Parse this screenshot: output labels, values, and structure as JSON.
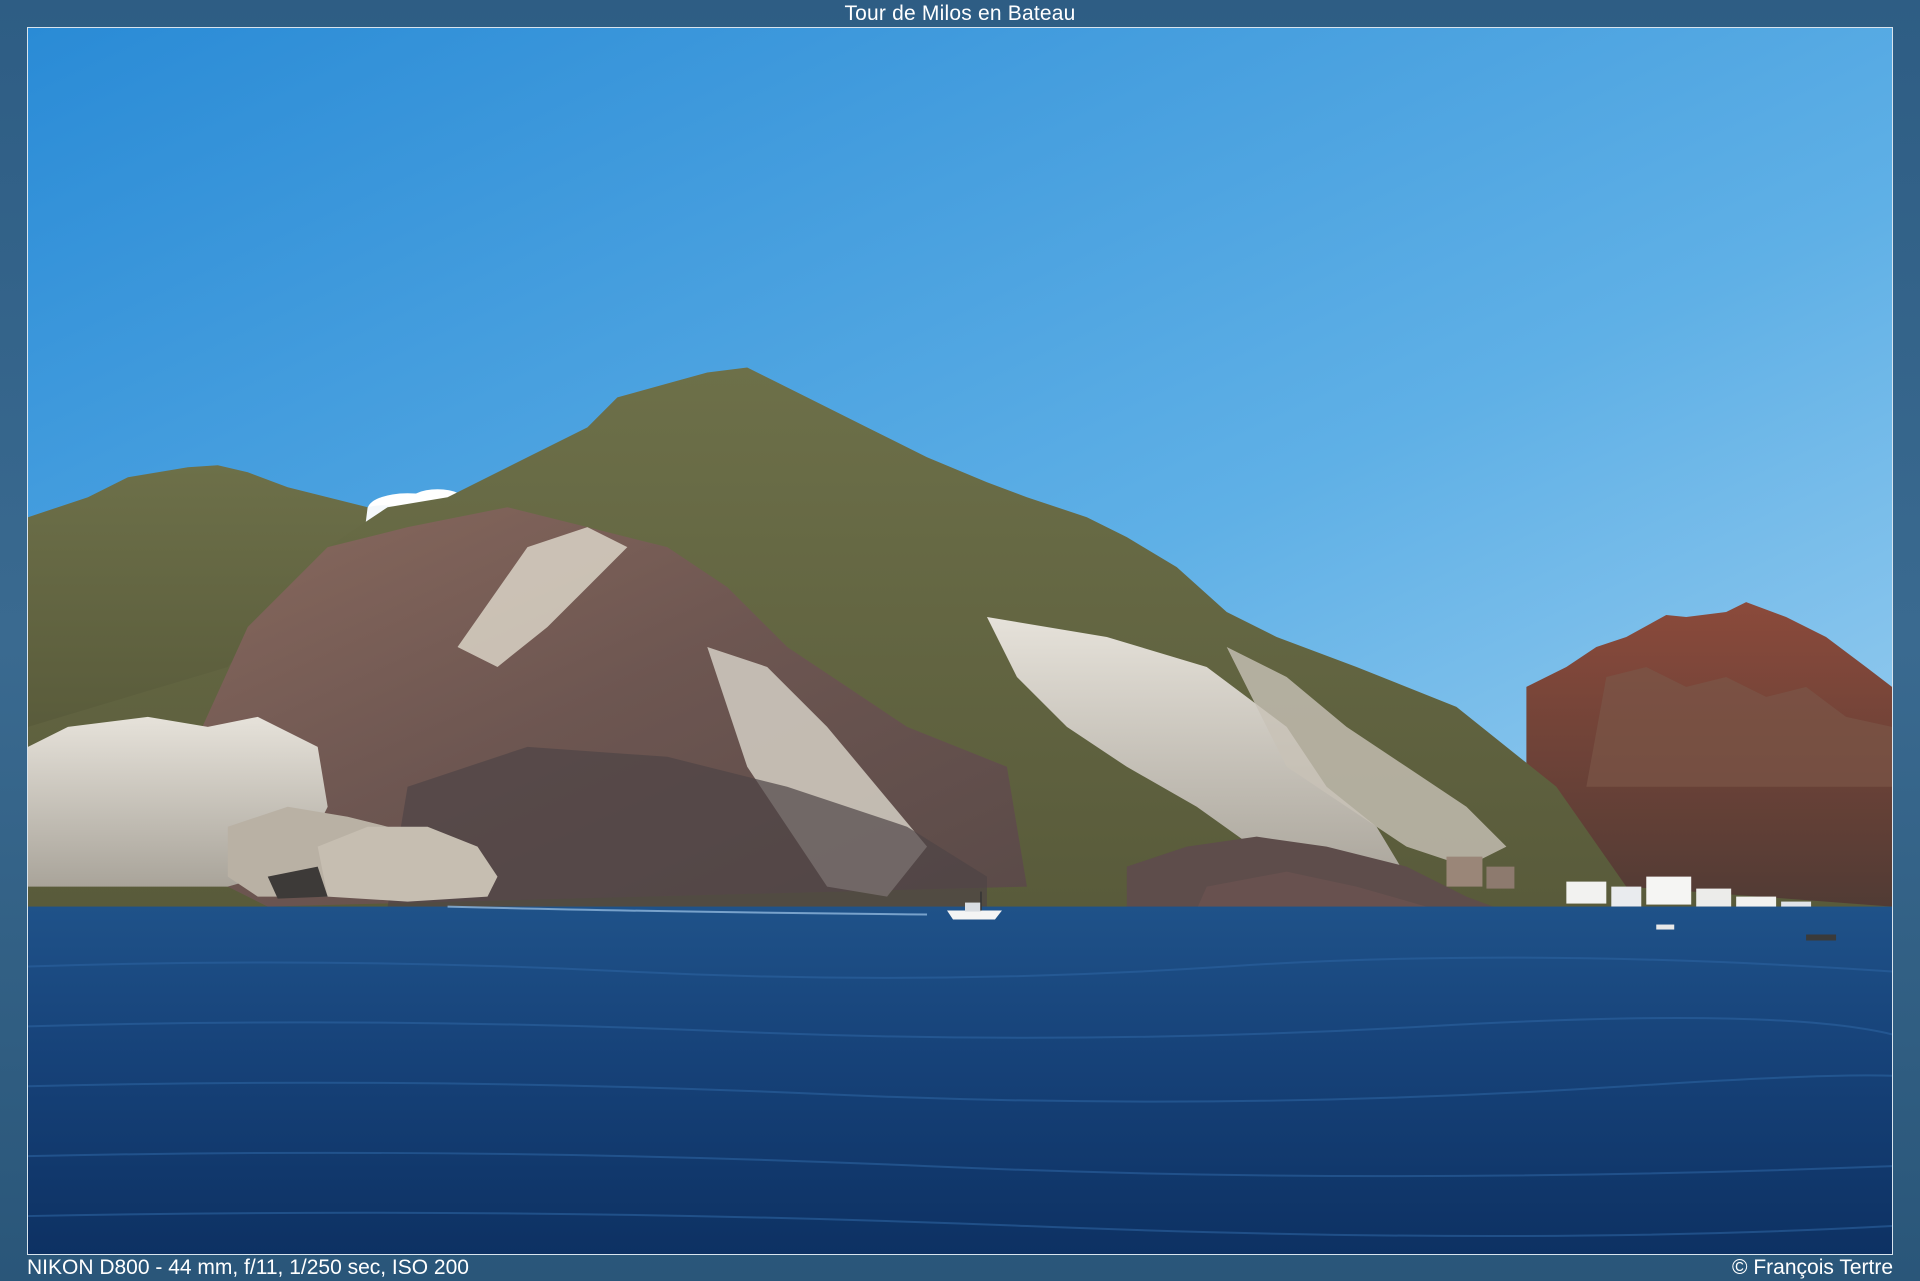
{
  "title": "Tour de Milos en Bateau",
  "exif": "NIKON D800 - 44 mm, f/11, 1/250 sec, ISO 200",
  "copyright": "© François Tertre",
  "colors": {
    "frame": "#2f5f86",
    "sky_top": "#2a8fd8",
    "sky_bottom": "#8cc6ec",
    "sea_top": "#1d4f86",
    "sea_bottom": "#0f3466",
    "hill_green": "#6b6f46",
    "cliff_white": "#d8d0c4",
    "cliff_red": "#7a4f44"
  }
}
